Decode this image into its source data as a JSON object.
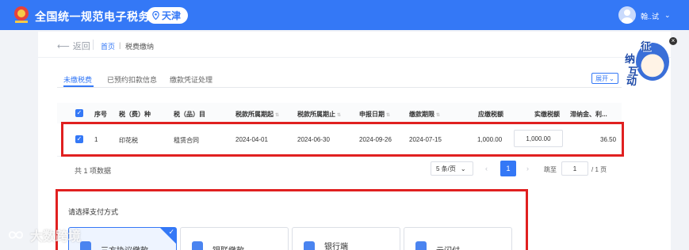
{
  "header": {
    "site_title": "全国统一规范电子税务局",
    "region": "天津",
    "user_name": "翰..试",
    "user_caret": "⌄"
  },
  "nav": {
    "back_label": "返回",
    "breadcrumb_home": "首页",
    "breadcrumb_sep": "|",
    "breadcrumb_current": "税费缴纳"
  },
  "tabs": [
    {
      "label": "未缴税费",
      "active": true
    },
    {
      "label": "已预约扣款信息",
      "active": false
    },
    {
      "label": "缴款凭证处理",
      "active": false
    }
  ],
  "expand_label": "展开",
  "table": {
    "columns": [
      "序号",
      "税（费）种",
      "税（品）目",
      "税款所属期起",
      "税款所属期止",
      "申报日期",
      "缴款期限",
      "应缴税额",
      "实缴税额",
      "滞纳金、利..."
    ],
    "rows": [
      {
        "index": "1",
        "tax_type": "印花税",
        "tax_item": "租赁合同",
        "period_start": "2024-04-01",
        "period_end": "2024-06-30",
        "declare_date": "2024-09-26",
        "due_date": "2024-07-15",
        "payable": "1,000.00",
        "paid": "1,000.00",
        "late_fee": "36.50"
      }
    ]
  },
  "pagination": {
    "total_text": "共 1 项数据",
    "page_size": "5 条/页",
    "current_page": "1",
    "goto_label": "跳至",
    "goto_value": "1",
    "goto_total": "/ 1 页"
  },
  "payment": {
    "heading": "请选择支付方式",
    "methods": [
      {
        "label": "三方协议缴款",
        "selected": true
      },
      {
        "label": "银联缴款",
        "selected": false
      },
      {
        "label": "银行端",
        "selected": false
      },
      {
        "label": "云闪付",
        "selected": false
      }
    ]
  },
  "mascot": {
    "chars": [
      "征",
      "纳",
      "互",
      "动"
    ]
  },
  "watermark": "大数跨境",
  "colors": {
    "brand": "#3478f6",
    "highlight": "#e02020"
  }
}
